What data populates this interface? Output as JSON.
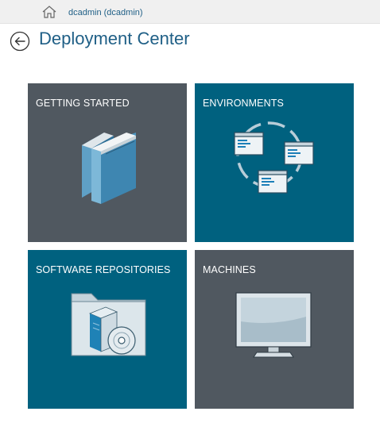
{
  "topbar": {
    "home_icon": "home-icon",
    "user_label": "dcadmin (dcadmin)"
  },
  "header": {
    "back_icon": "back-arrow-icon",
    "title": "Deployment Center"
  },
  "colors": {
    "accent": "#1f5f86",
    "tile_gray": "#505860",
    "tile_blue": "#00617f"
  },
  "tiles": [
    {
      "label": "GETTING STARTED",
      "icon": "books-icon",
      "color": "gray"
    },
    {
      "label": "ENVIRONMENTS",
      "icon": "environments-cycle-icon",
      "color": "blue"
    },
    {
      "label": "SOFTWARE REPOSITORIES",
      "icon": "software-folder-icon",
      "color": "blue"
    },
    {
      "label": "MACHINES",
      "icon": "monitor-icon",
      "color": "gray"
    }
  ]
}
